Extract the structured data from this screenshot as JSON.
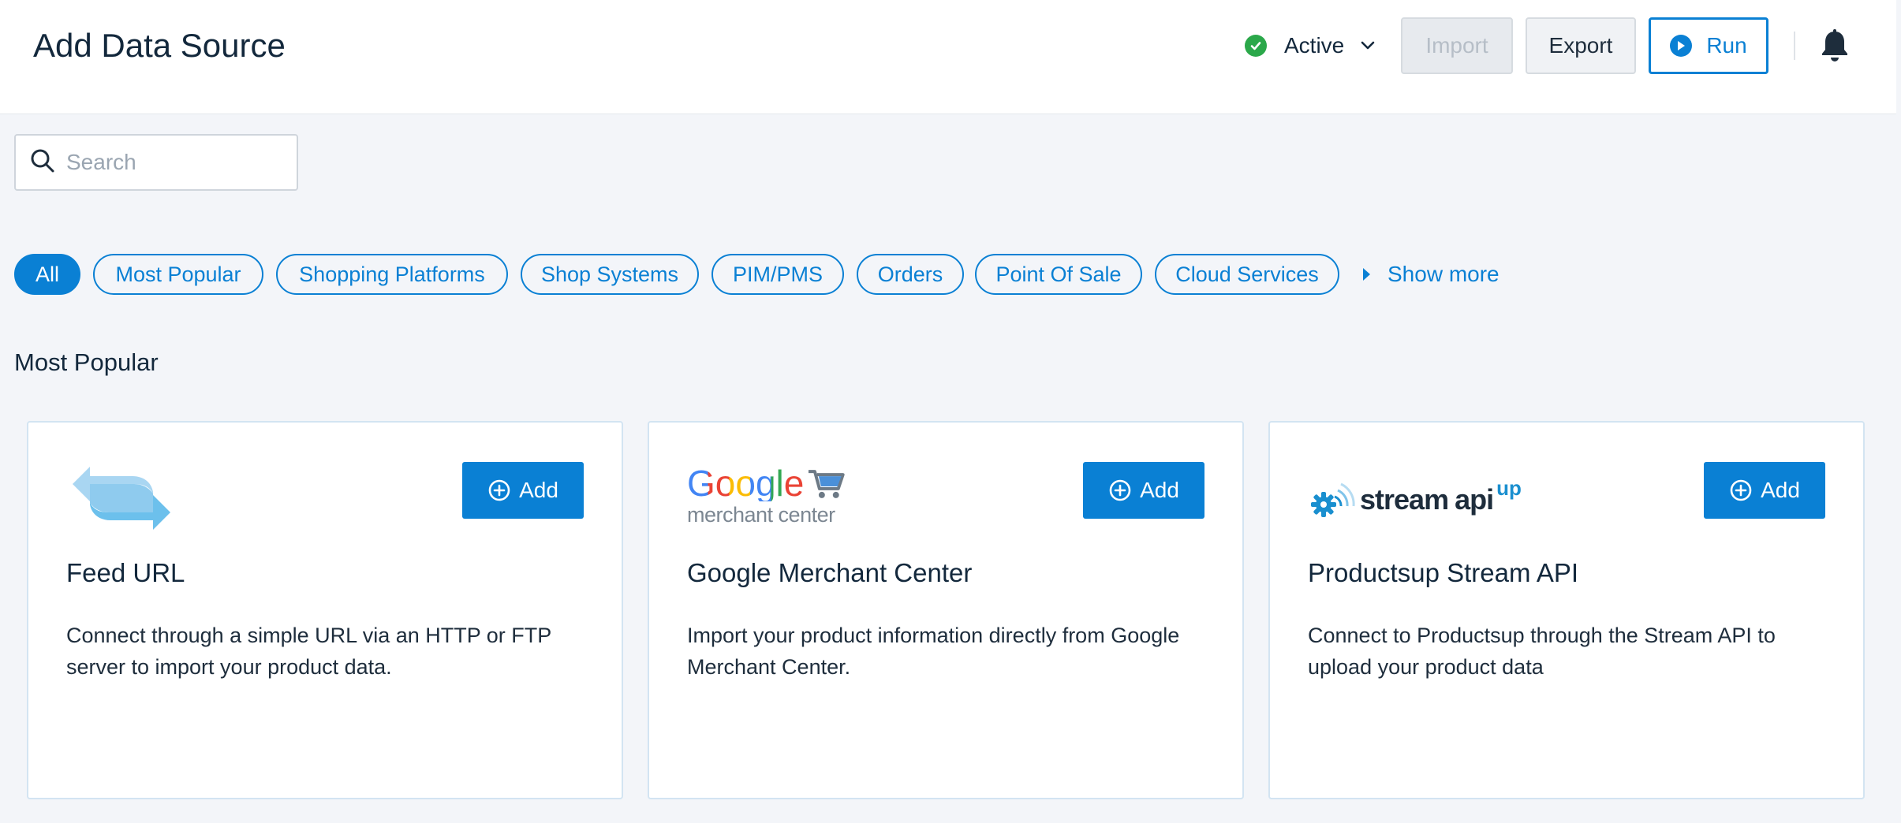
{
  "header": {
    "title": "Add Data Source",
    "status_label": "Active",
    "import_label": "Import",
    "export_label": "Export",
    "run_label": "Run"
  },
  "search": {
    "placeholder": "Search"
  },
  "filters": [
    "All",
    "Most Popular",
    "Shopping Platforms",
    "Shop Systems",
    "PIM/PMS",
    "Orders",
    "Point Of Sale",
    "Cloud Services"
  ],
  "show_more_label": "Show more",
  "section_title": "Most Popular",
  "cards": [
    {
      "title": "Feed URL",
      "description": "Connect through a simple URL via an HTTP or FTP server to import your product data.",
      "add_label": "Add"
    },
    {
      "title": "Google Merchant Center",
      "description": "Import your product information directly from Google Merchant Center.",
      "add_label": "Add",
      "logo_text": "Google",
      "logo_subtext": "merchant center"
    },
    {
      "title": "Productsup Stream API",
      "description": "Connect to Productsup through the Stream API to upload your product data",
      "add_label": "Add",
      "logo_text": "stream",
      "logo_text2": "api",
      "logo_sup": "up"
    }
  ],
  "colors": {
    "accent": "#0a80d4",
    "status_active": "#2ba84a",
    "title": "#13283c",
    "background": "#f3f5f9"
  },
  "icons": [
    "check-icon",
    "chevron-down-icon",
    "play-icon",
    "bell-icon",
    "search-icon",
    "plus-circle-icon",
    "caret-right-icon"
  ]
}
